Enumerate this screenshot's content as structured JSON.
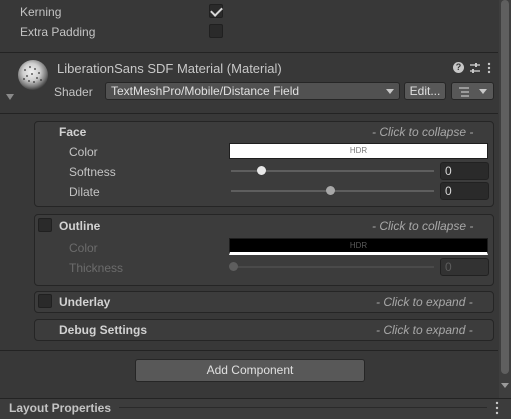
{
  "settings": {
    "kerning_label": "Kerning",
    "kerning_checked": true,
    "extra_padding_label": "Extra Padding",
    "extra_padding_checked": false
  },
  "material": {
    "title": "LiberationSans SDF Material (Material)",
    "shader_label": "Shader",
    "shader_value": "TextMeshPro/Mobile/Distance Field",
    "edit_button": "Edit...",
    "header_icons": [
      "help-icon",
      "preset-icon",
      "more-icon"
    ]
  },
  "face": {
    "title": "Face",
    "hint": "- Click to collapse -",
    "color_label": "Color",
    "color_hdr": "HDR",
    "color_swatch": "#ffffff",
    "softness_label": "Softness",
    "softness_value": "0",
    "dilate_label": "Dilate",
    "dilate_value": "0"
  },
  "outline": {
    "title": "Outline",
    "enabled": false,
    "hint": "- Click to collapse -",
    "color_label": "Color",
    "color_hdr": "HDR",
    "color_swatch": "#000000",
    "thickness_label": "Thickness",
    "thickness_value": "0"
  },
  "underlay": {
    "title": "Underlay",
    "enabled": false,
    "hint": "- Click to expand -"
  },
  "debug": {
    "title": "Debug Settings",
    "hint": "- Click to expand -"
  },
  "add_component_label": "Add Component",
  "layout_properties_label": "Layout Properties"
}
